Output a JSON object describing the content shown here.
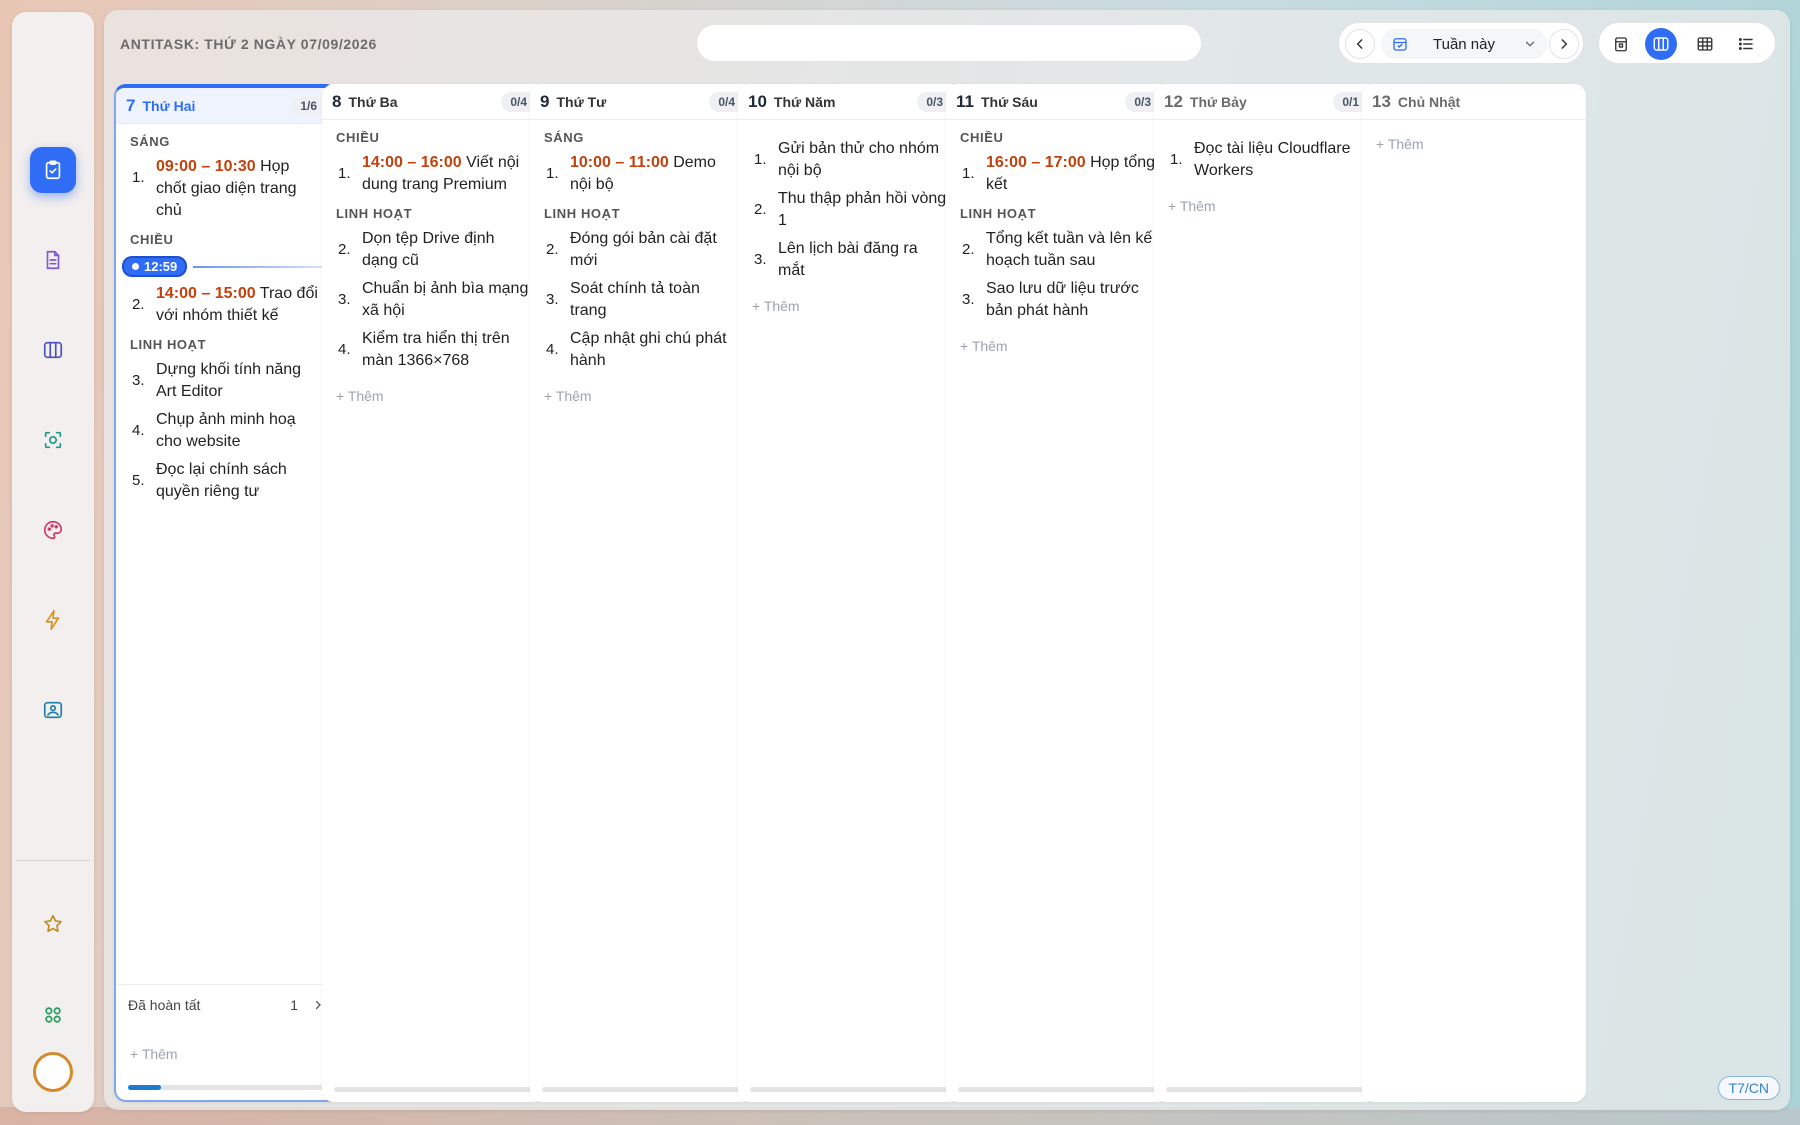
{
  "app": {
    "title": "ANTITASK: THỨ 2 NGÀY 07/09/2026"
  },
  "search": {
    "placeholder": ""
  },
  "week_nav": {
    "label": "Tuần này"
  },
  "colors": {
    "accent": "#2f6df6",
    "time": "#c2410c",
    "progress": "#1f78d1"
  },
  "sidebar": {
    "items": [
      {
        "icon": "clipboard-check-icon",
        "active": true
      },
      {
        "icon": "document-icon",
        "active": false
      },
      {
        "icon": "columns-icon",
        "active": false
      },
      {
        "icon": "scan-icon",
        "active": false
      },
      {
        "icon": "palette-icon",
        "active": false
      },
      {
        "icon": "lightning-icon",
        "active": false
      },
      {
        "icon": "image-icon",
        "active": false
      },
      {
        "icon": "star-icon",
        "active": false
      },
      {
        "icon": "apps-icon",
        "active": false
      }
    ]
  },
  "days": [
    {
      "num": "7",
      "name": "Thứ Hai",
      "count": "1/6",
      "today": true,
      "sections": [
        {
          "label": "SÁNG",
          "tasks": [
            {
              "n": "1.",
              "time": "09:00 – 10:30",
              "text": "Họp chốt giao diện trang chủ"
            }
          ]
        },
        {
          "label": "CHIỀU",
          "now": "12:59",
          "tasks": [
            {
              "n": "2.",
              "time": "14:00 – 15:00",
              "text": "Trao đổi với nhóm thiết kế"
            }
          ]
        },
        {
          "label": "LINH HOẠT",
          "tasks": [
            {
              "n": "3.",
              "time": "",
              "text": "Dựng khối tính năng Art Editor"
            },
            {
              "n": "4.",
              "time": "",
              "text": "Chụp ảnh minh hoạ cho website"
            },
            {
              "n": "5.",
              "time": "",
              "text": "Đọc lại chính sách quyền riêng tư"
            }
          ]
        }
      ],
      "done_label": "Đã hoàn tất",
      "done_count": "1",
      "add_label": "+ Thêm",
      "progress": 0.17
    },
    {
      "num": "8",
      "name": "Thứ Ba",
      "count": "0/4",
      "sections": [
        {
          "label": "CHIỀU",
          "tasks": [
            {
              "n": "1.",
              "time": "14:00 – 16:00",
              "text": "Viết nội dung trang Premium"
            }
          ]
        },
        {
          "label": "LINH HOẠT",
          "tasks": [
            {
              "n": "2.",
              "time": "",
              "text": "Dọn tệp Drive định dạng cũ"
            },
            {
              "n": "3.",
              "time": "",
              "text": "Chuẩn bị ảnh bìa mạng xã hội"
            },
            {
              "n": "4.",
              "time": "",
              "text": "Kiểm tra hiển thị trên màn 1366×768"
            }
          ]
        }
      ],
      "add_label": "+ Thêm",
      "progress": 0
    },
    {
      "num": "9",
      "name": "Thứ Tư",
      "count": "0/4",
      "sections": [
        {
          "label": "SÁNG",
          "tasks": [
            {
              "n": "1.",
              "time": "10:00 – 11:00",
              "text": "Demo nội bộ"
            }
          ]
        },
        {
          "label": "LINH HOẠT",
          "tasks": [
            {
              "n": "2.",
              "time": "",
              "text": "Đóng gói bản cài đặt mới"
            },
            {
              "n": "3.",
              "time": "",
              "text": "Soát chính tả toàn trang"
            },
            {
              "n": "4.",
              "time": "",
              "text": "Cập nhật ghi chú phát hành"
            }
          ]
        }
      ],
      "add_label": "+ Thêm",
      "progress": 0
    },
    {
      "num": "10",
      "name": "Thứ Năm",
      "count": "0/3",
      "sections": [
        {
          "label": "",
          "tasks": [
            {
              "n": "1.",
              "time": "",
              "text": "Gửi bản thử cho nhóm nội bộ"
            },
            {
              "n": "2.",
              "time": "",
              "text": "Thu thập phản hồi vòng 1"
            },
            {
              "n": "3.",
              "time": "",
              "text": "Lên lịch bài đăng ra mắt"
            }
          ]
        }
      ],
      "add_label": "+ Thêm",
      "progress": 0
    },
    {
      "num": "11",
      "name": "Thứ Sáu",
      "count": "0/3",
      "sections": [
        {
          "label": "CHIỀU",
          "tasks": [
            {
              "n": "1.",
              "time": "16:00 – 17:00",
              "text": "Họp tổng kết"
            }
          ]
        },
        {
          "label": "LINH HOẠT",
          "tasks": [
            {
              "n": "2.",
              "time": "",
              "text": "Tổng kết tuần và lên kế hoạch tuần sau"
            },
            {
              "n": "3.",
              "time": "",
              "text": "Sao lưu dữ liệu trước bản phát hành"
            }
          ]
        }
      ],
      "add_label": "+ Thêm",
      "progress": 0
    },
    {
      "num": "12",
      "name": "Thứ Bảy",
      "count": "0/1",
      "weekend": true,
      "sections": [
        {
          "label": "",
          "tasks": [
            {
              "n": "1.",
              "time": "",
              "text": "Đọc tài liệu Cloudflare Workers"
            }
          ]
        }
      ],
      "add_label": "+ Thêm",
      "progress": 0
    },
    {
      "num": "13",
      "name": "Chủ Nhật",
      "count": "",
      "weekend": true,
      "sections": [],
      "add_label": "+ Thêm",
      "no_bar": true
    }
  ],
  "weekend_chip": "T7/CN"
}
